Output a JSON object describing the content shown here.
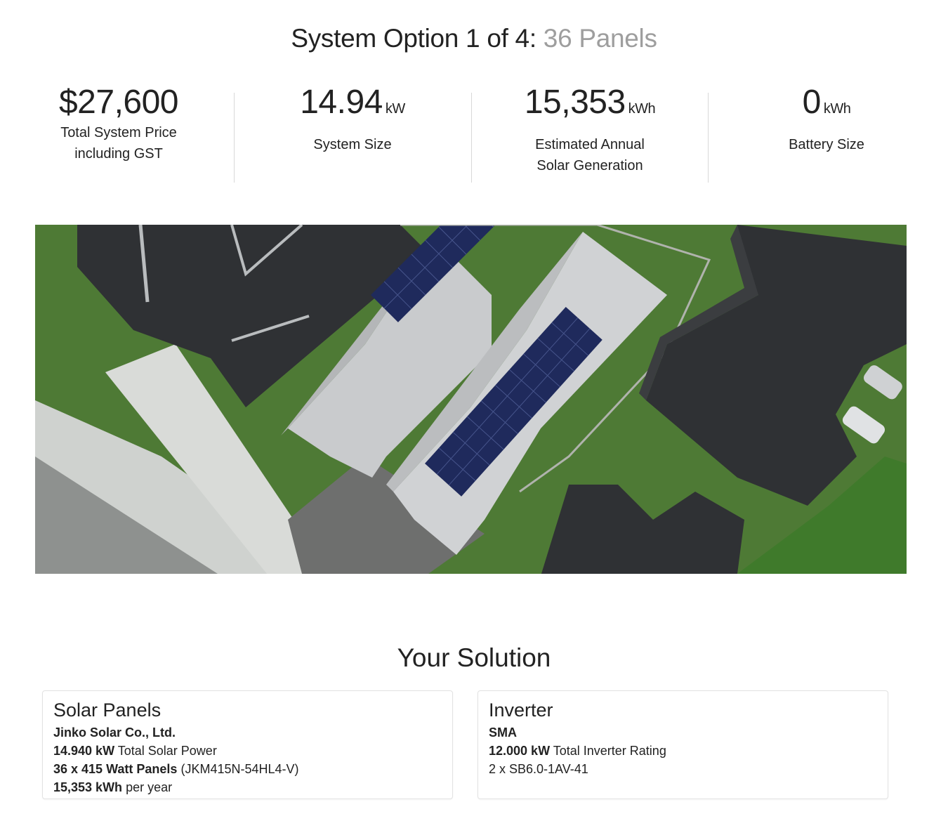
{
  "header": {
    "title_prefix": "System Option 1 of 4:",
    "title_panels": "36 Panels"
  },
  "stats": {
    "price": {
      "value": "$27,600",
      "label_line1": "Total System Price",
      "label_line2": "including GST"
    },
    "size": {
      "value": "14.94",
      "unit": "kW",
      "label_line1": "System Size"
    },
    "generation": {
      "value": "15,353",
      "unit": "kWh",
      "label_line1": "Estimated Annual",
      "label_line2": "Solar Generation"
    },
    "battery": {
      "value": "0",
      "unit": "kWh",
      "label_line1": "Battery Size"
    }
  },
  "solution": {
    "title": "Your Solution",
    "panels_card": {
      "heading": "Solar Panels",
      "manufacturer": "Jinko Solar Co., Ltd.",
      "power_value": "14.940 kW",
      "power_label": "Total Solar Power",
      "count_value": "36 x 415 Watt Panels",
      "model": "(JKM415N-54HL4-V)",
      "annual_value": "15,353 kWh",
      "annual_label": "per year"
    },
    "inverter_card": {
      "heading": "Inverter",
      "manufacturer": "SMA",
      "rating_value": "12.000 kW",
      "rating_label": "Total Inverter Rating",
      "model": "2 x SB6.0-1AV-41"
    }
  },
  "colors": {
    "title_muted": "#9e9e9e",
    "lawn": "#4e7a35",
    "roof_dark": "#2f3134",
    "roof_light": "#c9cbcd",
    "solar_panel": "#1f2a5c"
  }
}
